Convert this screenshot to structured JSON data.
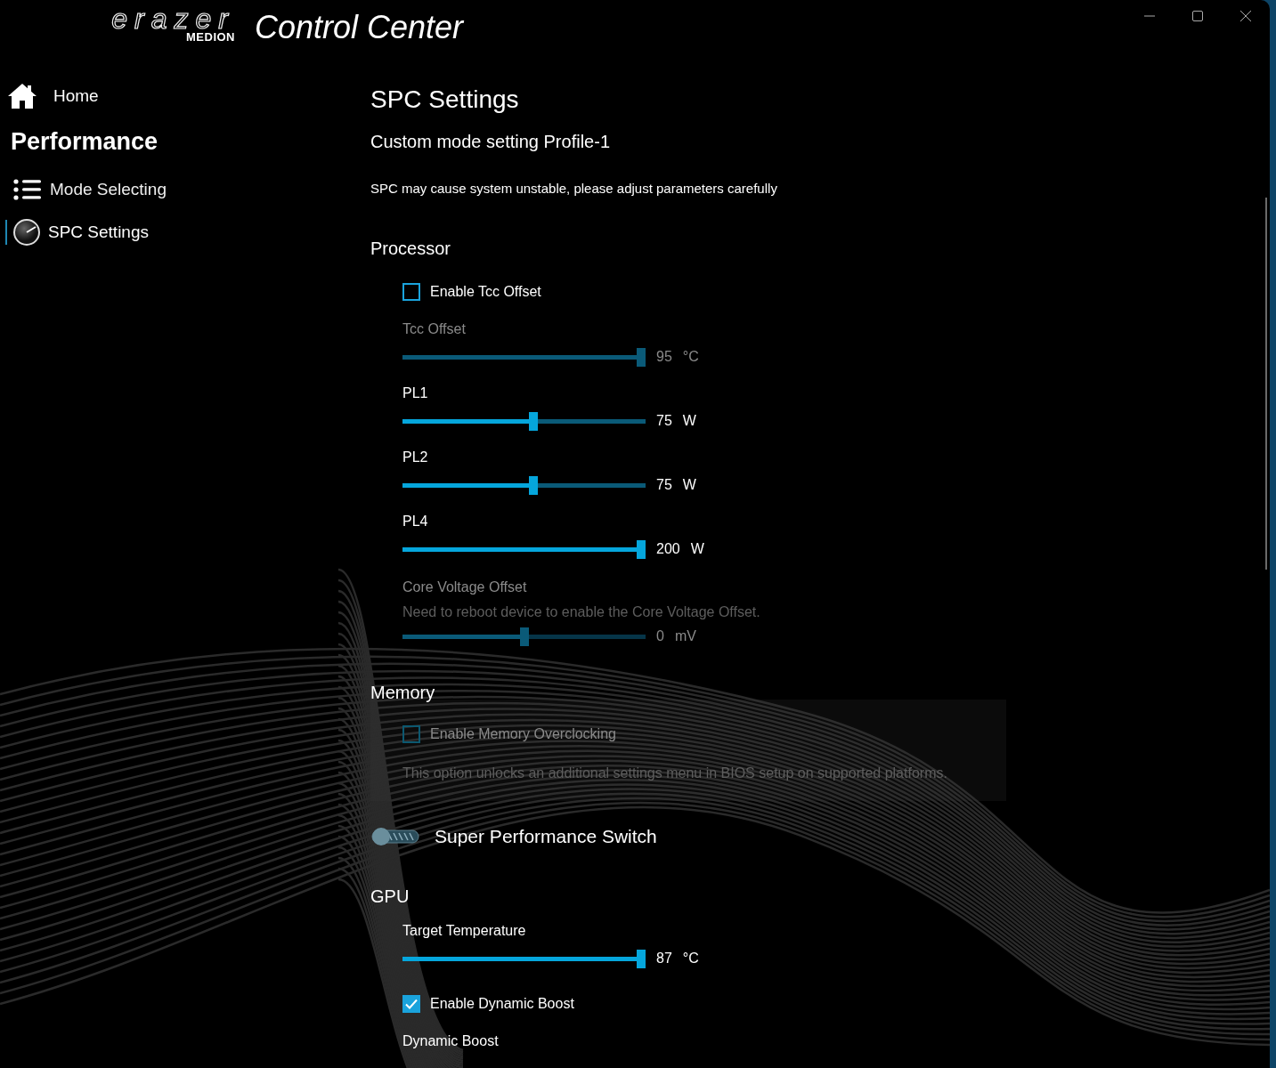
{
  "window": {
    "logo_word": "erazer",
    "logo_brand": "MEDION",
    "title": "Control Center"
  },
  "sidebar": {
    "home": {
      "label": "Home"
    },
    "section_title": "Performance",
    "items": [
      {
        "label": "Mode Selecting",
        "selected": false
      },
      {
        "label": "SPC Settings",
        "selected": true
      }
    ]
  },
  "content": {
    "title": "SPC Settings",
    "subtitle": "Custom mode setting Profile-1",
    "warning": "SPC may cause system unstable, please adjust parameters carefully",
    "sections": [
      {
        "kind": "heading",
        "label": "Processor"
      },
      {
        "kind": "checkbox",
        "label": "Enable Tcc Offset",
        "checked": false,
        "disabled": false
      },
      {
        "kind": "slider",
        "label": "Tcc Offset",
        "level": 1,
        "value": "95",
        "unit": "°C",
        "disabled": true
      },
      {
        "kind": "slider",
        "label": "PL1",
        "level": 0.54,
        "value": "75",
        "unit": "W",
        "disabled": false
      },
      {
        "kind": "slider",
        "label": "PL2",
        "level": 0.54,
        "value": "75",
        "unit": "W",
        "disabled": false
      },
      {
        "kind": "slider",
        "label": "PL4",
        "level": 1,
        "value": "200",
        "unit": "W",
        "disabled": false
      },
      {
        "kind": "slider",
        "label": "Core Voltage Offset",
        "note": "Need to reboot device to enable the Core Voltage Offset.",
        "level": 0.5,
        "value": "0",
        "unit": "mV",
        "disabled": true
      },
      {
        "kind": "heading",
        "label": "Memory"
      },
      {
        "kind": "panel",
        "items": [
          {
            "kind": "checkbox",
            "label": "Enable Memory Overclocking",
            "checked": false,
            "disabled": true
          },
          {
            "kind": "note",
            "label": "This option unlocks an additional settings menu in BIOS setup on supported platforms.",
            "disabled": true
          }
        ]
      },
      {
        "kind": "switch",
        "label": "Super Performance Switch",
        "on": false
      },
      {
        "kind": "heading",
        "label": "GPU"
      },
      {
        "kind": "slider",
        "label": "Target Temperature",
        "level": 1,
        "value": "87",
        "unit": "°C",
        "disabled": false
      },
      {
        "kind": "checkbox",
        "label": "Enable Dynamic Boost",
        "checked": true,
        "disabled": false
      },
      {
        "kind": "label",
        "label": "Dynamic Boost"
      }
    ]
  }
}
